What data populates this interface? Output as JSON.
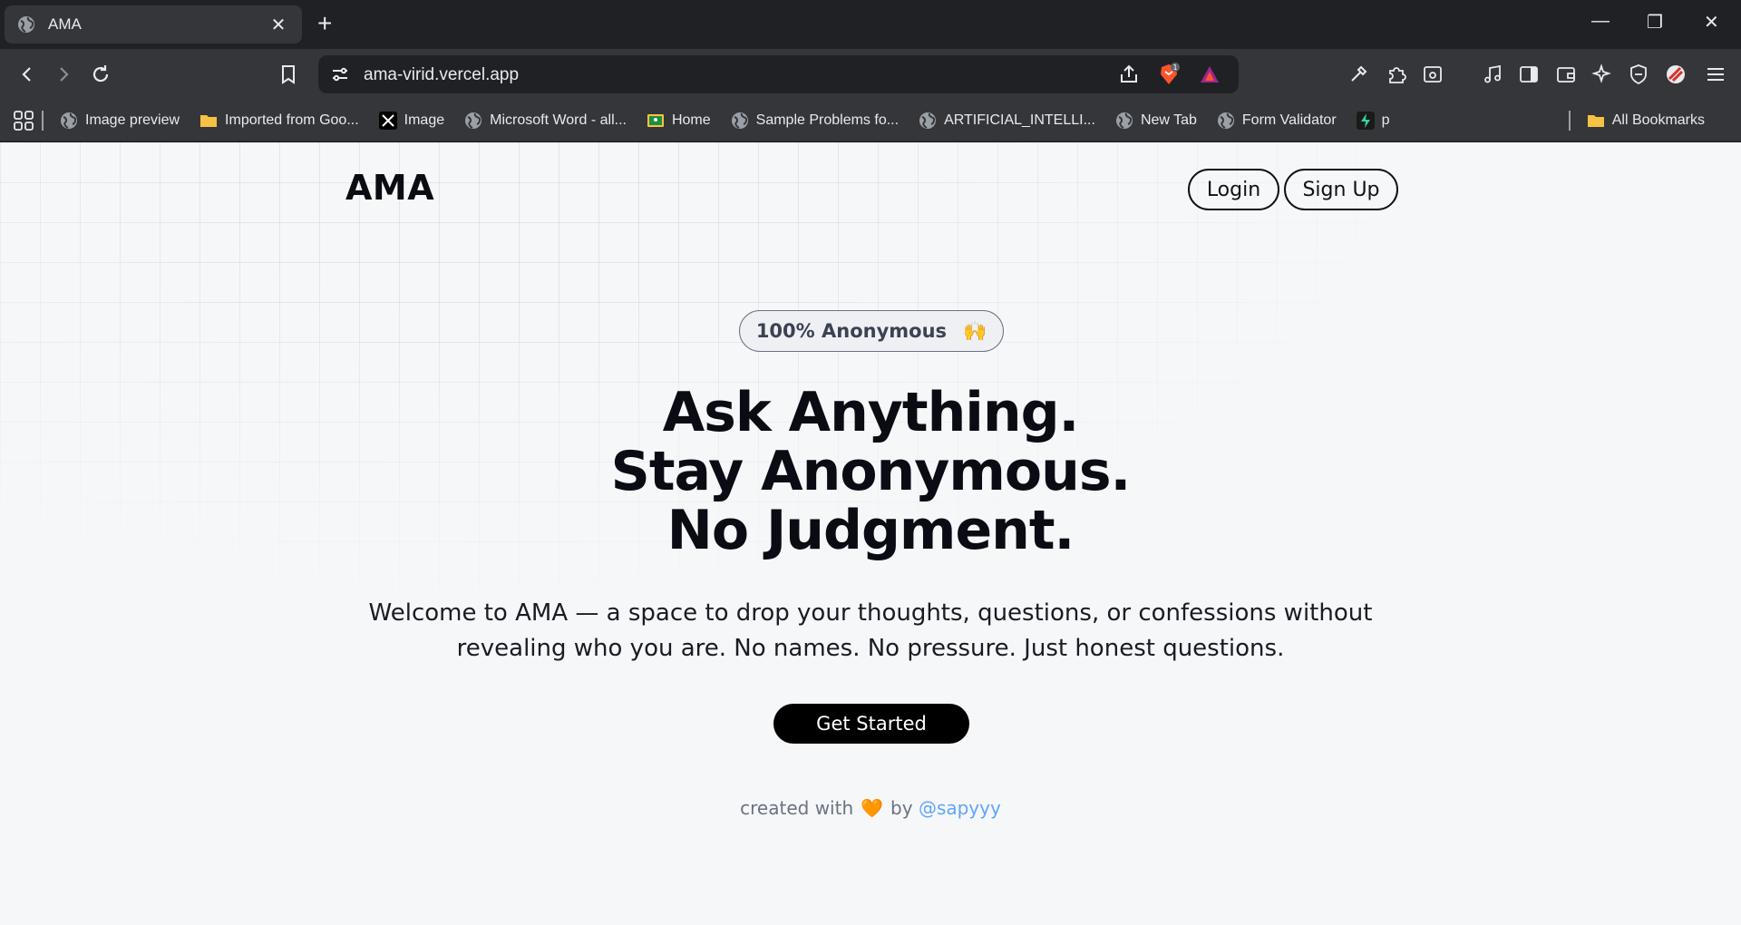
{
  "browser": {
    "tab_title": "AMA",
    "new_tab": "+",
    "url": "ama-virid.vercel.app",
    "brave_badge": "1",
    "bookmarks": [
      {
        "label": "Image preview",
        "icon": "globe-icon"
      },
      {
        "label": "Imported from Goo...",
        "icon": "folder-icon"
      },
      {
        "label": "Image",
        "icon": "x-logo-icon"
      },
      {
        "label": "Microsoft Word - all...",
        "icon": "globe-icon"
      },
      {
        "label": "Home",
        "icon": "classroom-icon"
      },
      {
        "label": "Sample Problems fo...",
        "icon": "globe-icon"
      },
      {
        "label": "ARTIFICIAL_INTELLI...",
        "icon": "globe-icon"
      },
      {
        "label": "New Tab",
        "icon": "globe-icon"
      },
      {
        "label": "Form Validator",
        "icon": "globe-icon"
      },
      {
        "label": "p",
        "icon": "bolt-icon"
      }
    ],
    "all_bookmarks": "All Bookmarks"
  },
  "page": {
    "logo": "AMA",
    "nav": {
      "login": "Login",
      "signup": "Sign Up"
    },
    "badge": {
      "text": "100% Anonymous",
      "emoji": "🙌"
    },
    "hero": {
      "line1": "Ask Anything.",
      "line2": "Stay Anonymous.",
      "line3": "No Judgment."
    },
    "subtitle_line1": "Welcome to AMA — a space to drop your thoughts, questions, or confessions without",
    "subtitle_line2": "revealing who you are. No names. No pressure. Just honest questions.",
    "cta": "Get Started",
    "footer": {
      "prefix": "created with",
      "heart": "🧡",
      "by": "by",
      "handle": "@sapyyy"
    }
  },
  "colors": {
    "accent": "#000000",
    "link": "#60a5fa",
    "chrome": "#35363a"
  }
}
